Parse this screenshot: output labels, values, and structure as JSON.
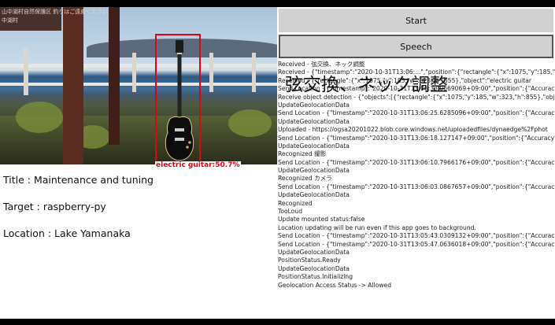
{
  "preview": {
    "sign_lines": [
      "山中湖村自然保護区 釣りはご遠慮ください",
      "中湖村"
    ],
    "detection_label": "electric guitar:50.7%"
  },
  "info": {
    "title": "Title : Maintenance and tuning",
    "target": "Target : raspberry-py",
    "location": "Location : Lake Yamanaka"
  },
  "buttons": {
    "start": "Start",
    "speech": "Speech"
  },
  "overlay_text": "弦交換、ネック調整",
  "log_lines": [
    "Received - 弦交換、ネック調整",
    "Received - {\"timestamp\":\"2020-10-31T13:06:...\",\"position\":{\"rectangle\":{\"x\":1075,\"y\":185,\"w\":323,\"h\":855},\"object\"",
    "Received - {\"rectangle\":{\"x\":1075,\"y\":185,\"w\":323,\"h\":855},\"object\":\"electric guitar",
    "Send Location - {\"timestamp\":\"2020-10-31T13:06:33.0669069+09:00\",\"position\":{\"Accuracy\"",
    "Receive object detection - {\"objects\":[{\"rectangle\":{\"x\":1075,\"y\":185,\"w\":323,\"h\":855},\"object\"",
    "UpdateGeolocationData",
    "Send Location - {\"timestamp\":\"2020-10-31T13:06:25.6285096+09:00\",\"position\":{\"Accuracy\"",
    "UpdateGeolocationData",
    "Uploaded - https://ogsa20201022.blob.core.windows.net/uploadedfiles/dynaedge%2Fphot",
    "Send Location - {\"timestamp\":\"2020-10-31T13:06:18.127147+09:00\",\"position\":{\"Accuracy\":5",
    "UpdateGeolocationData",
    "Recognized 撮影",
    "Send Location - {\"timestamp\":\"2020-10-31T13:06:10.7966176+09:00\",\"position\":{\"Accuracy\"",
    "UpdateGeolocationData",
    "Recognized カメラ",
    "Send Location - {\"timestamp\":\"2020-10-31T13:06:03.0867657+09:00\",\"position\":{\"Accuracy\"",
    "UpdateGeolocationData",
    "Recognized",
    "TooLoud",
    "Update mounted status:false",
    "Location updating will be run even if this app goes to background.",
    "Send Location - {\"timestamp\":\"2020-10-31T13:05:43.0309132+09:00\",\"position\":{\"Accuracy\"",
    "Send Location - {\"timestamp\":\"2020-10-31T13:05:47.0636018+09:00\",\"position\":{\"Accuracy\"",
    "UpdateGeolocationData",
    "PositionStatus.Ready",
    "UpdateGeolocationData",
    "PositionStatus.Initializing",
    "Geolocation Access Status -> Allowed"
  ],
  "colors": {
    "detection": "#e8000c",
    "button_bg": "#d1d1d1",
    "focus_border": "#555555"
  }
}
